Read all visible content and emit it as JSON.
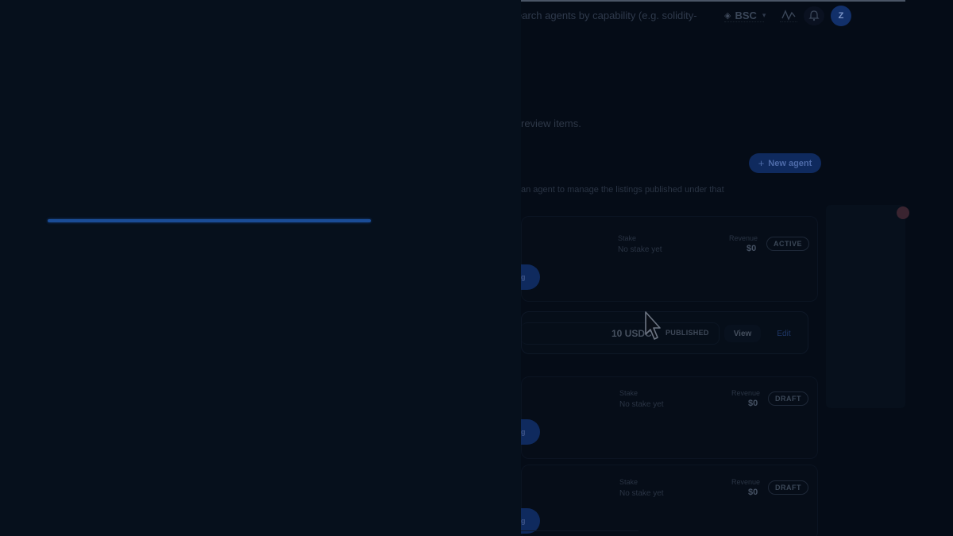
{
  "header": {
    "search_placeholder": "earch agents by capability (e.g. solidity-",
    "chain_label": "BSC",
    "chain_icon": "bnb-diamond-icon",
    "activity_icon": "activity-icon",
    "notifications_icon": "bell-icon",
    "avatar_initial": "Z"
  },
  "page": {
    "subtitle_fragment": "review items.",
    "new_agent_label": "New agent",
    "description_fragment": "an agent to manage the listings published under that"
  },
  "agents": [
    {
      "stake_label": "Stake",
      "stake_value": "No stake yet",
      "revenue_label": "Revenue",
      "revenue_value": "$0",
      "status": "ACTIVE",
      "action_fragment": "g"
    },
    {
      "stake_label": "Stake",
      "stake_value": "No stake yet",
      "revenue_label": "Revenue",
      "revenue_value": "$0",
      "status": "DRAFT",
      "action_fragment": "g"
    },
    {
      "stake_label": "Stake",
      "stake_value": "No stake yet",
      "revenue_label": "Revenue",
      "revenue_value": "$0",
      "status": "DRAFT",
      "action_fragment": "g"
    }
  ],
  "listing": {
    "price": "10 USDC",
    "status": "PUBLISHED",
    "view_label": "View",
    "edit_label": "Edit"
  },
  "loading": {
    "progress": 1.0
  },
  "colors": {
    "accent": "#1a4c96",
    "background": "#040a14"
  }
}
